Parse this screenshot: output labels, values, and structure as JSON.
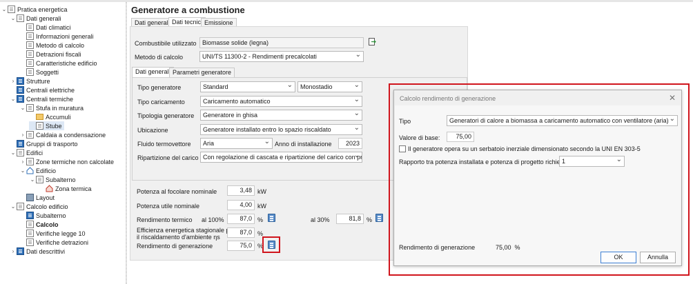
{
  "tree": {
    "items": [
      {
        "label": "Pratica energetica",
        "icon": "doc-icon"
      },
      {
        "label": "Dati generali",
        "icon": "doc-icon"
      },
      {
        "label": "Dati climatici",
        "icon": "doc-icon"
      },
      {
        "label": "Informazioni generali",
        "icon": "doc-icon"
      },
      {
        "label": "Metodo di calcolo",
        "icon": "doc-icon"
      },
      {
        "label": "Detrazioni fiscali",
        "icon": "doc-icon"
      },
      {
        "label": "Caratteristiche edificio",
        "icon": "doc-icon"
      },
      {
        "label": "Soggetti",
        "icon": "doc-icon"
      },
      {
        "label": "Strutture",
        "icon": "blue-doc-icon"
      },
      {
        "label": "Centrali elettriche",
        "icon": "blue-doc-icon"
      },
      {
        "label": "Centrali termiche",
        "icon": "blue-doc-icon"
      },
      {
        "label": "Stufa in muratura",
        "icon": "doc-icon"
      },
      {
        "label": "Accumuli",
        "icon": "folder-icon"
      },
      {
        "label": "Stube",
        "icon": "doc-icon"
      },
      {
        "label": "Caldaia a condensazione",
        "icon": "doc-icon"
      },
      {
        "label": "Gruppi di trasporto",
        "icon": "blue-doc-icon"
      },
      {
        "label": "Edifici",
        "icon": "doc-icon"
      },
      {
        "label": "Zone termiche non calcolate",
        "icon": "doc-icon"
      },
      {
        "label": "Edificio",
        "icon": "house-icon"
      },
      {
        "label": "Subalterno",
        "icon": "doc-icon"
      },
      {
        "label": "Zona termica",
        "icon": "house-icon"
      },
      {
        "label": "Layout",
        "icon": "layout-icon"
      },
      {
        "label": "Calcolo edificio",
        "icon": "doc-icon"
      },
      {
        "label": "Subalterno",
        "icon": "blue-doc-icon"
      },
      {
        "label": "Calcolo",
        "icon": "doc-icon"
      },
      {
        "label": "Verifiche legge 10",
        "icon": "doc-icon"
      },
      {
        "label": "Verifiche detrazioni",
        "icon": "doc-icon"
      },
      {
        "label": "Dati descrittivi",
        "icon": "blue-doc-icon"
      }
    ]
  },
  "main": {
    "title": "Generatore a combustione",
    "tabs": [
      "Dati generali",
      "Dati tecnici",
      "Emissione"
    ],
    "combustibile_label": "Combustibile utilizzato",
    "combustibile_value": "Biomasse solide (legna)",
    "metodo_label": "Metodo di calcolo",
    "metodo_value": "UNI/TS 11300-2 - Rendimenti precalcolati",
    "inner_tabs": [
      "Dati generali",
      "Parametri generatore"
    ],
    "tipo_generatore_label": "Tipo generatore",
    "tipo_generatore_value": "Standard",
    "stadi_value": "Monostadio",
    "tipo_caricamento_label": "Tipo caricamento",
    "tipo_caricamento_value": "Caricamento automatico",
    "tipologia_label": "Tipologia generatore",
    "tipologia_value": "Generatore in ghisa",
    "ubicazione_label": "Ubicazione",
    "ubicazione_value": "Generatore installato entro lo spazio riscaldato",
    "fluido_label": "Fluido termovettore",
    "fluido_value": "Aria",
    "anno_label": "Anno di installazione",
    "anno_value": "2023",
    "ripartizione_label": "Ripartizione del carico",
    "ripartizione_value": "Con regolazione di cascata e ripartizione del carico con priorità",
    "potenza_focolare_label": "Potenza al focolare nominale",
    "potenza_focolare_value": "3,48",
    "potenza_utile_label": "Potenza utile nominale",
    "potenza_utile_value": "4,00",
    "unit_kw": "kW",
    "rendimento_termico_label": "Rendimento termico",
    "al100_label": "al 100%",
    "al100_value": "87,0",
    "al30_label": "al 30%",
    "al30_value": "81,8",
    "efficienza_label_1": "Efficienza energetica stagionale per",
    "efficienza_label_2": "il riscaldamento d'ambiente ηs",
    "efficienza_value": "87,0",
    "rendimento_gen_label": "Rendimento di generazione",
    "rendimento_gen_value": "75,0",
    "unit_pct": "%"
  },
  "dialog": {
    "title": "Calcolo rendimento di generazione",
    "tipo_label": "Tipo",
    "tipo_value": "Generatori di calore a biomassa a caricamento automatico con ventilatore (aria)",
    "valore_base_label": "Valore di base:",
    "valore_base_value": "75,00",
    "serbatoio_label": "Il generatore opera su un serbatoio inerziale dimensionato secondo la UNI EN 303-5",
    "rapporto_label": "Rapporto tra potenza installata e potenza di progetto richiesta:",
    "rapporto_value": "1",
    "rendimento_label": "Rendimento di generazione",
    "rendimento_value": "75,00",
    "rendimento_unit": "%",
    "ok_label": "OK",
    "annulla_label": "Annulla"
  },
  "colors": {
    "highlight": "#d0141c",
    "accent": "#2f6fb7"
  }
}
